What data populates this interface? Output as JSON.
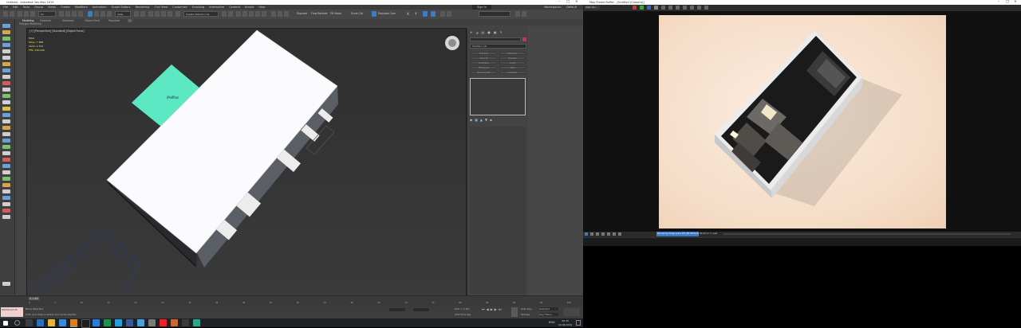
{
  "max": {
    "title": "Untitled - Autodesk 3ds Max 2019",
    "menu": [
      "File",
      "Edit",
      "Tools",
      "Group",
      "Views",
      "Create",
      "Modifiers",
      "Animation",
      "Graph Editors",
      "Rendering",
      "Civil View",
      "Customize",
      "Scripting",
      "Interactive",
      "Content",
      "Arnold",
      "Help"
    ],
    "signin": "Sign In",
    "workspace_label": "Workspaces:",
    "workspace_value": "Default",
    "selection_filter": "All",
    "view_select": "View",
    "create_selection_set": "Create Selection Se",
    "explorer": "Explorer",
    "flow_retimer": "Flow Retimer",
    "fill_mode": "Fill Mode",
    "scale_label": "Scale Ctrl",
    "populate_label": "Populate Cam",
    "ribbon_tabs": [
      "Modeling",
      "Freeform",
      "Selection",
      "Object Paint",
      "Populate"
    ],
    "ribbon_sub": "Polygon Modeling",
    "viewport_label": "[+] [Perspective] [Standard] [Edged Faces]",
    "stats": {
      "title": "Total",
      "polys_label": "Polys:",
      "polys_value": "7 888",
      "verts_label": "Verts:",
      "verts_value": "4 314",
      "fps_label": "FPS:",
      "fps_value": "226,046"
    },
    "plane_label": "iPolPlan",
    "cmd": {
      "name_field": "",
      "modifier_list": "Modifier List",
      "buttons": [
        "Edit Poly",
        "Edit Mesh",
        "Extrude",
        "Chamfer",
        "Symmetry",
        "Lathe",
        "FFD 4x4x4",
        "Shell",
        "Turbosmooth",
        "UVW Map"
      ]
    },
    "timeline": {
      "frame": "0 / 100",
      "ticks": [
        "0",
        "5",
        "10",
        "15",
        "20",
        "25",
        "30",
        "35",
        "40",
        "45",
        "50",
        "55",
        "60",
        "65",
        "70",
        "75",
        "80",
        "85",
        "90",
        "95",
        "100"
      ]
    },
    "status": {
      "maxscript": "MAXScript Mi",
      "selected": "None Selected",
      "hint": "Click and drag to select and move objects",
      "grid": "Grid = 1,0m",
      "add_time_tag": "Add Time Tag",
      "auto_key": "Auto Key",
      "selected_label": "Selected",
      "set_key": "Set Key",
      "key_filters": "Key Filters..."
    }
  },
  "taskbar": {
    "lang": "ENG",
    "time": "20:15",
    "date": "10.06.2019"
  },
  "fb": {
    "title": "Max Frame Buffer - [Untitled (Camera)]",
    "channel": "RGB color",
    "status": "Rendering image [pass 20] [00:00:04.6]",
    "status2": "00:00:17.7 / Last"
  },
  "colors": {
    "accent": "#3c7bc6",
    "plane": "#5ce8c2",
    "viewport_bg": "#333333",
    "render_bg": "#f5dcc6"
  }
}
